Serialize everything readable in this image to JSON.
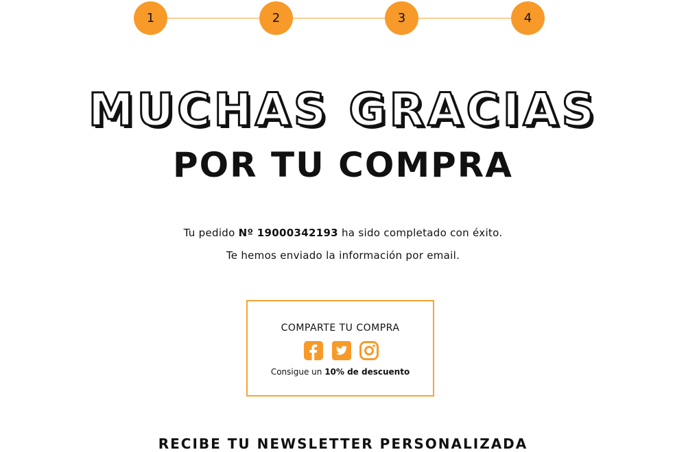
{
  "steps": [
    "1",
    "2",
    "3",
    "4"
  ],
  "colors": {
    "accent": "#f79a2a",
    "border": "#f7a435",
    "text": "#111111"
  },
  "heading": {
    "line1": "MUCHAS GRACIAS",
    "line2": "POR TU COMPRA"
  },
  "order": {
    "prefix": "Tu pedido",
    "number": "Nº 19000342193",
    "suffix": "ha sido completado con éxito.",
    "email_note": "Te hemos enviado la información por email."
  },
  "share": {
    "title": "COMPARTE TU COMPRA",
    "icons": [
      "facebook-icon",
      "twitter-icon",
      "instagram-icon"
    ],
    "promo_prefix": "Consigue un",
    "promo_bold": "10% de descuento"
  },
  "newsletter": {
    "title": "RECIBE TU NEWSLETTER PERSONALIZADA"
  }
}
